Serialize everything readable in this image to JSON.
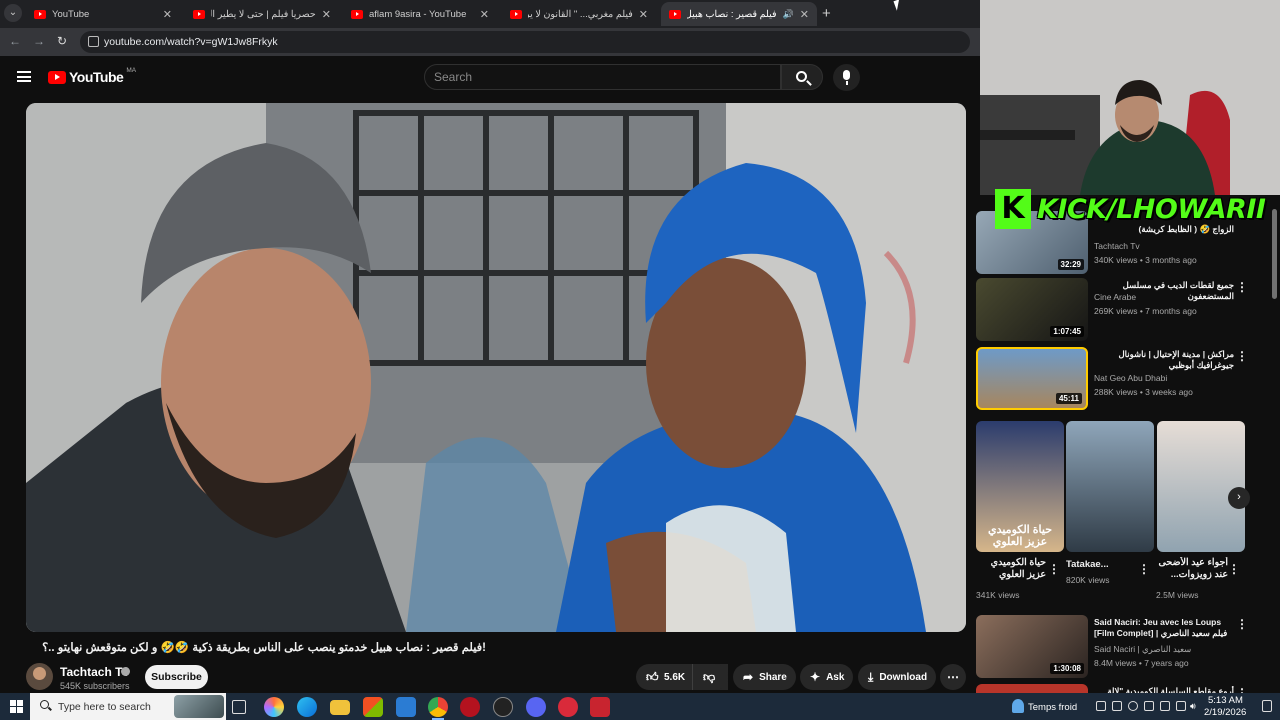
{
  "browser": {
    "tabs": [
      {
        "label": "YouTube",
        "active": false
      },
      {
        "label": "حصريا فيلم | حتى لا يطير الدخان",
        "active": false
      },
      {
        "label": "aflam 9asira - YouTube",
        "active": false
      },
      {
        "label": "فيلم مغربي... \" القانون لا يرحم \" -",
        "active": false
      },
      {
        "label": "فيلم قصير : نصاب هبيل خد...",
        "active": true
      }
    ],
    "url": "youtube.com/watch?v=gW1Jw8Frkyk"
  },
  "youtube": {
    "logo_text": "YouTube",
    "country_code": "MA",
    "search_placeholder": "Search"
  },
  "video": {
    "title": "!فيلم قصير : نصاب هبيل خدمتو ينصب على الناس بطريقة ذكية 🤣🤣 و لكن متوقعش نهايتو ..؟",
    "channel_name": "Tachtach Tv",
    "subscribers": "545K subscribers",
    "subscribe_label": "Subscribe",
    "likes": "5.6K",
    "share_label": "Share",
    "ask_label": "Ask",
    "download_label": "Download"
  },
  "related": [
    {
      "title": "الزواج 🤣 ( الظابط كريشة)",
      "channel": "Tachtach Tv",
      "meta": "340K views • 3 months ago",
      "duration": "32:29",
      "thumb_color": "#7c8fa0",
      "verified": true
    },
    {
      "title": "جميع لقطات الديب في مسلسل المستضعفون",
      "channel": "Cine Arabe",
      "meta": "269K views • 7 months ago",
      "duration": "1:07:45",
      "thumb_color": "#2a2f22",
      "verified": false
    },
    {
      "title": "مراكش | مدينة الإحتيال | ناشونال جيوغرافيك أبوظبي",
      "channel": "Nat Geo Abu Dhabi",
      "meta": "288K views • 3 weeks ago",
      "duration": "45:11",
      "thumb_color": "#3a6da3",
      "verified": false
    },
    {
      "title": "Said Naciri: Jeu avec les Loups [Film Complet] | فيلم سعيد الناصري",
      "channel": "Said Naciri | سعيد الناصري",
      "meta": "8.4M views • 7 years ago",
      "duration": "1:30:08",
      "thumb_color": "#5c4d45",
      "verified": true
    },
    {
      "title": "أروع مقاطع السلسلة الكوميدية \"لالة فاطمة\"",
      "channel": "",
      "meta": "",
      "duration": "",
      "thumb_color": "#b8352a",
      "verified": false
    }
  ],
  "shorts": [
    {
      "title": "حياة الكوميدي عزيز العلوي كلها...",
      "views": "341K views",
      "overlay": "حياة الكوميدي عزيز العلوي كاملا...",
      "color": "#b9a37a"
    },
    {
      "title": "Tatakae...",
      "views": "820K views",
      "overlay": "",
      "color": "#6c8196"
    },
    {
      "title": "أجواء عيد الأضحى عند زويزوات...",
      "views": "2.5M views",
      "overlay": "",
      "color": "#d9cfc8"
    }
  ],
  "overlay": {
    "kick_letter": "K",
    "kick_text": "KICK/LHOWARII"
  },
  "taskbar": {
    "search_placeholder": "Type here to search",
    "weather": "Temps froid",
    "time": "5:13 AM",
    "date": "2/19/2026"
  }
}
